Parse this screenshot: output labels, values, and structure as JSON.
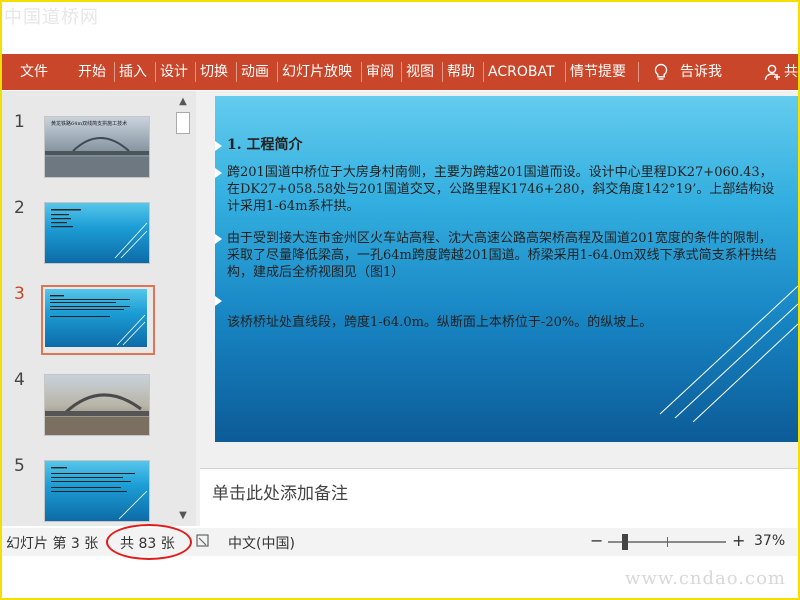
{
  "watermarks": {
    "top": "中国道桥网",
    "bottom": "www.cndao.com"
  },
  "ribbon": {
    "tabs": [
      "文件",
      "开始",
      "插入",
      "设计",
      "切换",
      "动画",
      "幻灯片放映",
      "审阅",
      "视图",
      "帮助",
      "ACROBAT",
      "情节提要"
    ],
    "tell_me": "告诉我",
    "share": "共",
    "colors": {
      "ribbon": "#c9462a"
    }
  },
  "thumbnails": {
    "items": [
      {
        "number": "1",
        "title": "黄龙铁路64m双线简支拱施工技术"
      },
      {
        "number": "2"
      },
      {
        "number": "3",
        "selected": true
      },
      {
        "number": "4"
      },
      {
        "number": "5"
      }
    ]
  },
  "slide": {
    "title": "1. 工程简介",
    "paragraphs": [
      "跨201国道中桥位于大房身村南侧，主要为跨越201国道而设。设计中心里程DK27+060.43，在DK27+058.58处与201国道交叉，公路里程K1746+280，斜交角度142°19’。上部结构设计采用1-64m系杆拱。",
      "由于受到接大连市金州区火车站高程、沈大高速公路高架桥高程及国道201宽度的条件的限制，采取了尽量降低梁高，一孔64m跨度跨越201国道。桥梁采用1-64.0m双线下承式简支系杆拱结构，建成后全桥视图见（图1）",
      "该桥桥址处直线段，跨度1-64.0m。纵断面上本桥位于-20%。的纵坡上。"
    ]
  },
  "notes": {
    "placeholder": "单击此处添加备注"
  },
  "status": {
    "slide_label": "幻灯片 第 3 张",
    "total_label": "共 83 张",
    "language": "中文(中国)",
    "zoom_minus": "−",
    "zoom_plus": "+",
    "zoom": "37%"
  }
}
